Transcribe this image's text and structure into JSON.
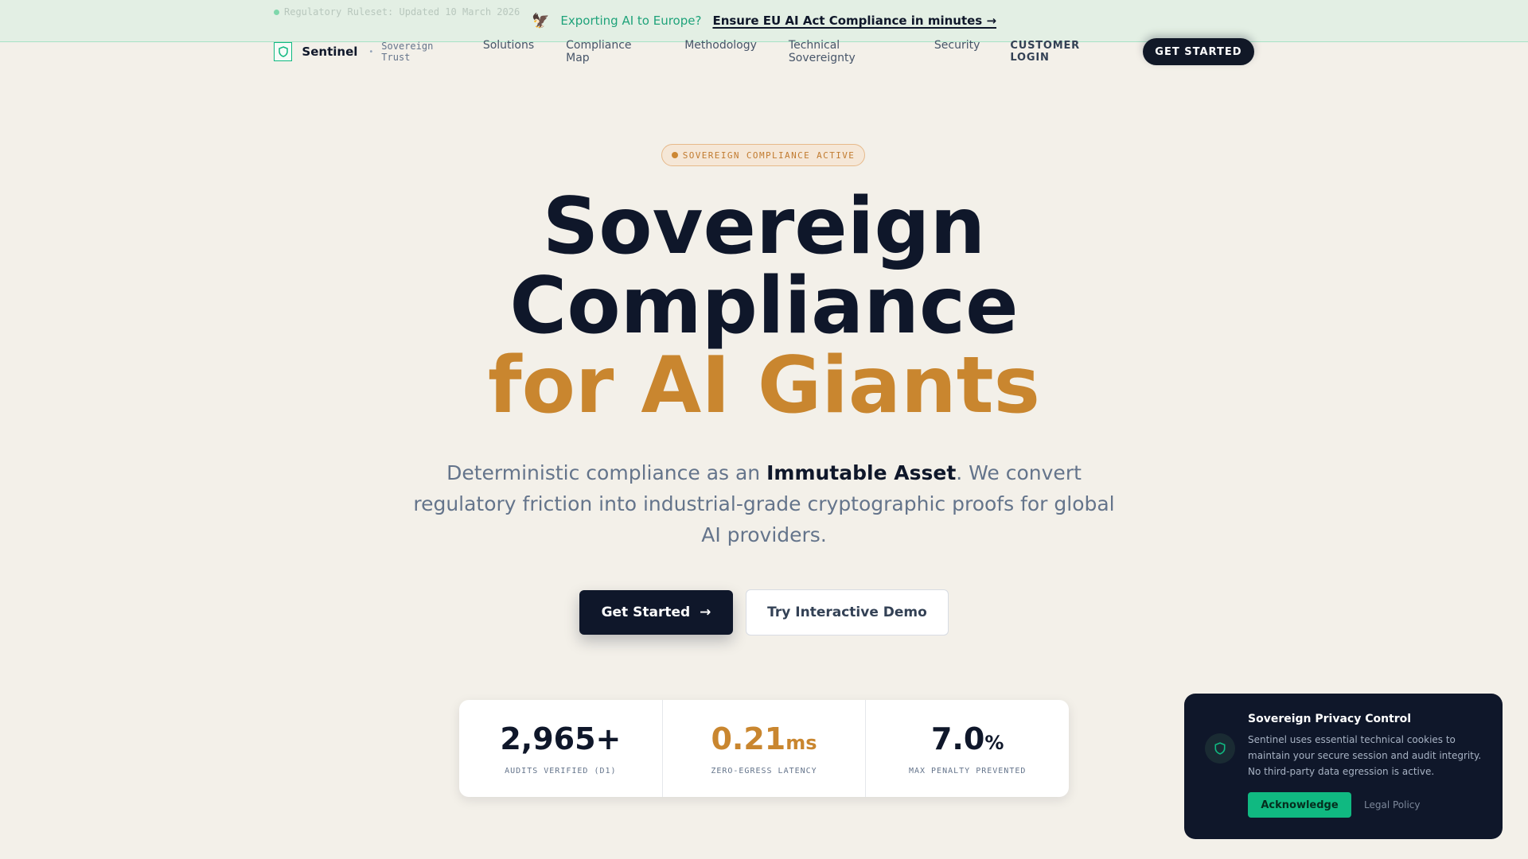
{
  "announcement": {
    "ruleset": "Regulatory Ruleset: Updated 10 March 2026",
    "icon": "eagle-icon",
    "question": "Exporting AI to Europe?",
    "cta": "Ensure EU AI Act Compliance in minutes →"
  },
  "nav": {
    "brand": "Sentinel",
    "separator": "•",
    "tagline": "Sovereign Trust",
    "links": [
      "Solutions",
      "Compliance Map",
      "Methodology",
      "Technical Sovereignty",
      "Security"
    ],
    "login": "CUSTOMER LOGIN",
    "get_started": "GET STARTED"
  },
  "badge": "SOVEREIGN COMPLIANCE ACTIVE",
  "hero": {
    "line1": "Sovereign",
    "line2": "Compliance",
    "line3": "for AI Giants"
  },
  "subtitle": {
    "before": "Deterministic compliance as an ",
    "bold": "Immutable Asset",
    "after": ". We convert regulatory friction into industrial-grade cryptographic proofs for global AI providers."
  },
  "buttons": {
    "primary": "Get Started",
    "primary_arrow": "→",
    "secondary": "Try Interactive Demo"
  },
  "stats": [
    {
      "value": "2,965+",
      "unit": "",
      "label": "AUDITS VERIFIED (D1)"
    },
    {
      "value": "0.21",
      "unit": "ms",
      "label": "ZERO-EGRESS LATENCY"
    },
    {
      "value": "7.0",
      "unit": "%",
      "label": "MAX PENALTY PREVENTED"
    }
  ],
  "privacy": {
    "title": "Sovereign Privacy Control",
    "text": "Sentinel uses essential technical cookies to maintain your secure session and audit integrity. No third-party data egression is active.",
    "acknowledge": "Acknowledge",
    "legal": "Legal Policy"
  },
  "colors": {
    "accent_gold": "#c9862f",
    "accent_green": "#10b981",
    "navy": "#0f172a",
    "background": "#f3f0e9"
  }
}
